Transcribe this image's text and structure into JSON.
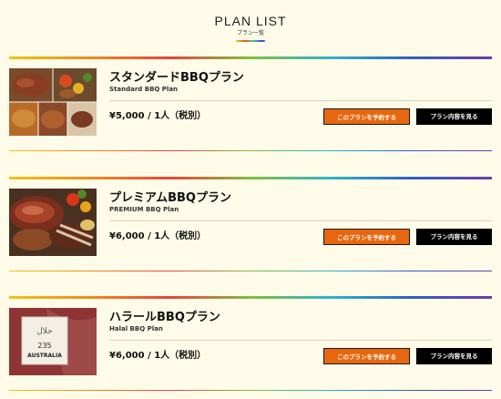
{
  "header": {
    "title": "PLAN LIST",
    "subtitle": "プラン一覧"
  },
  "colors": {
    "background": "#fffbe9",
    "reserve_button": "#e8670e",
    "details_button": "#000000",
    "rainbow": [
      "#f2c313",
      "#f08b1c",
      "#e8443a",
      "#7fbf3f",
      "#2fb3c9",
      "#2f5fbf",
      "#6b3fa8"
    ]
  },
  "plans": [
    {
      "name": "スタンダードBBQプラン",
      "name_en": "Standard BBQ Plan",
      "price": "¥5,000 / 1人（税別）",
      "reserve_label": "このプランを予約する",
      "details_label": "プラン内容を見る",
      "image": "bbq-food-collage"
    },
    {
      "name": "プレミアムBBQプラン",
      "name_en": "PREMIUM BBQ Plan",
      "price": "¥6,000 / 1人（税別）",
      "reserve_label": "このプランを予約する",
      "details_label": "プラン内容を見る",
      "image": "premium-bbq-meat"
    },
    {
      "name": "ハラールBBQプラン",
      "name_en": "Halal BBQ Plan",
      "price": "¥6,000 / 1人（税別）",
      "reserve_label": "このプランを予約する",
      "details_label": "プラン内容を見る",
      "image": "halal-beef-label",
      "image_label_text": [
        "235",
        "AUSTRALIA"
      ]
    }
  ]
}
